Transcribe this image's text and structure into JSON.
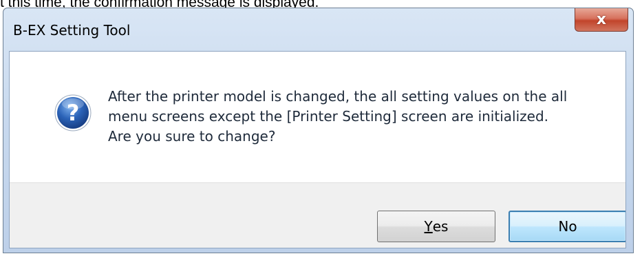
{
  "page": {
    "caption": "t this time, the confirmation message is displayed."
  },
  "dialog": {
    "title": "B-EX Setting Tool",
    "close_glyph": "x",
    "icon": "question-icon",
    "message_lines": [
      "After the printer model is changed, the all setting values on the all",
      "menu screens except the [Printer Setting] screen are initialized.",
      "Are you sure to change?"
    ],
    "buttons": {
      "yes": {
        "access_key": "Y",
        "rest": "es"
      },
      "no": {
        "label": "No",
        "default": true
      }
    }
  },
  "colors": {
    "titlebar": "#c8d9ee",
    "close_button": "#c2442b",
    "default_button_border": "#3c7fb1",
    "icon_blue": "#2b63b8"
  }
}
